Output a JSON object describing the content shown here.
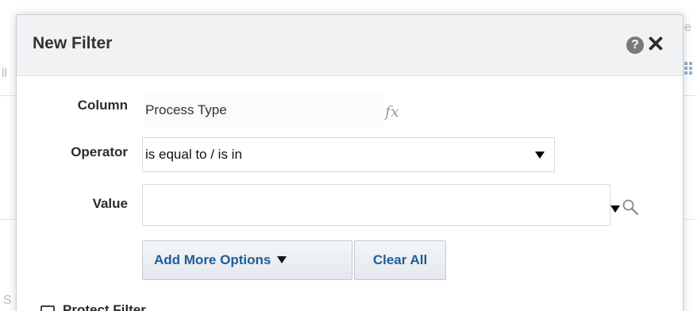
{
  "dialog": {
    "title": "New Filter",
    "help_icon": "help-icon",
    "help_glyph": "?",
    "close_icon": "close-icon",
    "close_glyph": "✕"
  },
  "form": {
    "column_label": "Column",
    "column_value": "Process Type",
    "fx_label": "fx",
    "operator_label": "Operator",
    "operator_value": "is equal to / is in",
    "value_label": "Value",
    "value_text": ""
  },
  "buttons": {
    "add_more_options": "Add More Options",
    "clear_all": "Clear All"
  },
  "options": {
    "protect_filter_label": "Protect Filter",
    "protect_filter_checked": false
  },
  "background": {
    "frag_top_right": "e",
    "frag_left_mid": "ll",
    "frag_left_bottom": "S"
  },
  "colors": {
    "button_text": "#1d5c9a",
    "header_bg": "#f0f2f4",
    "help_icon_bg": "#7a7a7a"
  }
}
